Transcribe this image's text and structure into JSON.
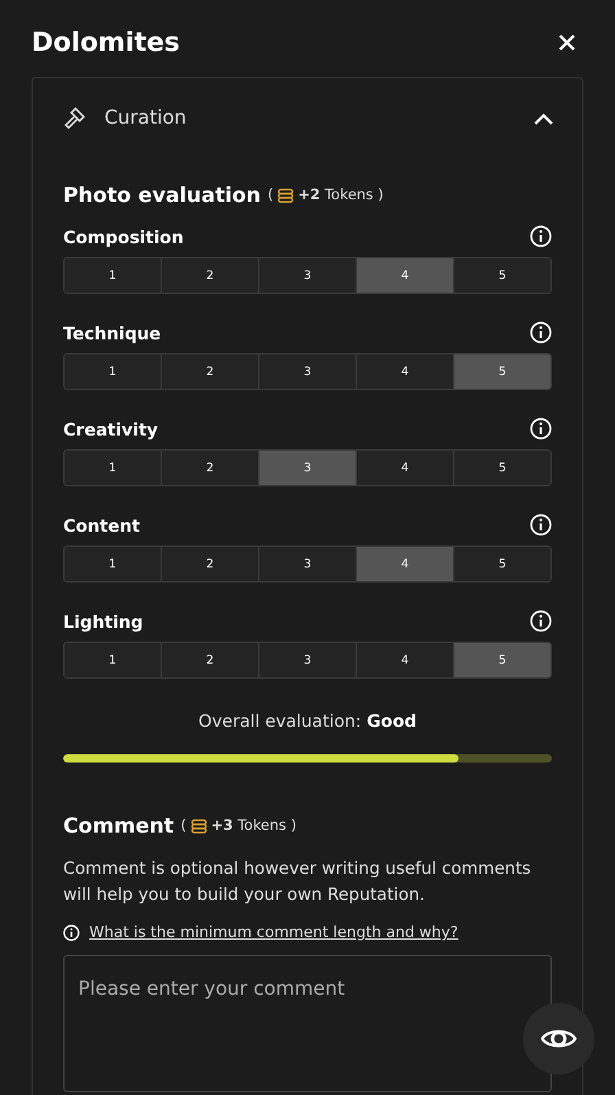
{
  "title": "Dolomites",
  "panel": {
    "label": "Curation",
    "expanded": true
  },
  "evaluation": {
    "title": "Photo evaluation",
    "paren_open": "(",
    "tokens": "**+2** Tokens )",
    "criteria": [
      {
        "name": "Composition",
        "options": [
          {
            "label": "1",
            "selected": false
          },
          {
            "label": "2",
            "selected": false
          },
          {
            "label": "3",
            "selected": false
          },
          {
            "label": "4",
            "selected": true
          },
          {
            "label": "5",
            "selected": false
          }
        ]
      },
      {
        "name": "Technique",
        "options": [
          {
            "label": "1",
            "selected": false
          },
          {
            "label": "2",
            "selected": false
          },
          {
            "label": "3",
            "selected": false
          },
          {
            "label": "4",
            "selected": false
          },
          {
            "label": "5",
            "selected": true
          }
        ]
      },
      {
        "name": "Creativity",
        "options": [
          {
            "label": "1",
            "selected": false
          },
          {
            "label": "2",
            "selected": false
          },
          {
            "label": "3",
            "selected": true
          },
          {
            "label": "4",
            "selected": false
          },
          {
            "label": "5",
            "selected": false
          }
        ]
      },
      {
        "name": "Content",
        "options": [
          {
            "label": "1",
            "selected": false
          },
          {
            "label": "2",
            "selected": false
          },
          {
            "label": "3",
            "selected": false
          },
          {
            "label": "4",
            "selected": true
          },
          {
            "label": "5",
            "selected": false
          }
        ]
      },
      {
        "name": "Lighting",
        "options": [
          {
            "label": "1",
            "selected": false
          },
          {
            "label": "2",
            "selected": false
          },
          {
            "label": "3",
            "selected": false
          },
          {
            "label": "4",
            "selected": false
          },
          {
            "label": "5",
            "selected": true
          }
        ]
      }
    ],
    "overall_label": "Overall evaluation:",
    "overall_value": "Good",
    "level": 0.81
  },
  "comment": {
    "title": "Comment",
    "paren_open": "(",
    "tokens": "**+3** Tokens )",
    "description": "Comment is optional however writing useful comments will help you to build your own Reputation.",
    "help_link": "What is the minimum comment length and why?",
    "placeholder": "Please enter your comment"
  }
}
